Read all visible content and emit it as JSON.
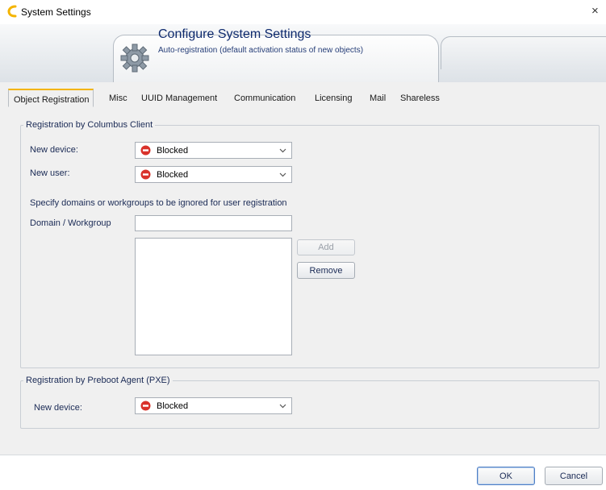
{
  "window": {
    "title": "System Settings",
    "close_glyph": "×",
    "logo_icon": "columbus-c-logo-icon",
    "logo_color": "#f4b400"
  },
  "header": {
    "title": "Configure System Settings",
    "subtitle": "Auto-registration (default activation status of new objects)",
    "icon": "gear-icon"
  },
  "tabs": [
    {
      "label": "Object Registration",
      "active": true
    },
    {
      "label": "Misc",
      "active": false
    },
    {
      "label": "UUID Management",
      "active": false
    },
    {
      "label": "Communication",
      "active": false
    },
    {
      "label": "Licensing",
      "active": false
    },
    {
      "label": "Mail",
      "active": false
    },
    {
      "label": "Shareless",
      "active": false
    }
  ],
  "client_group": {
    "title": "Registration by Columbus Client",
    "new_device": {
      "label": "New device:",
      "value": "Blocked",
      "icon": "blocked-icon"
    },
    "new_user": {
      "label": "New user:",
      "value": "Blocked",
      "icon": "blocked-icon"
    },
    "ignore_hint": "Specify domains or workgroups to be ignored for user registration",
    "domain": {
      "label": "Domain / Workgroup",
      "value": "",
      "placeholder": ""
    },
    "domain_list": [],
    "add_label": "Add",
    "remove_label": "Remove"
  },
  "pxe_group": {
    "title": "Registration by Preboot Agent (PXE)",
    "new_device": {
      "label": "New device:",
      "value": "Blocked",
      "icon": "blocked-icon"
    }
  },
  "footer": {
    "ok_label": "OK",
    "cancel_label": "Cancel"
  },
  "colors": {
    "blocked": "#d9322b",
    "active_tab_accent": "#f4b400",
    "label_text": "#1a2a55"
  }
}
